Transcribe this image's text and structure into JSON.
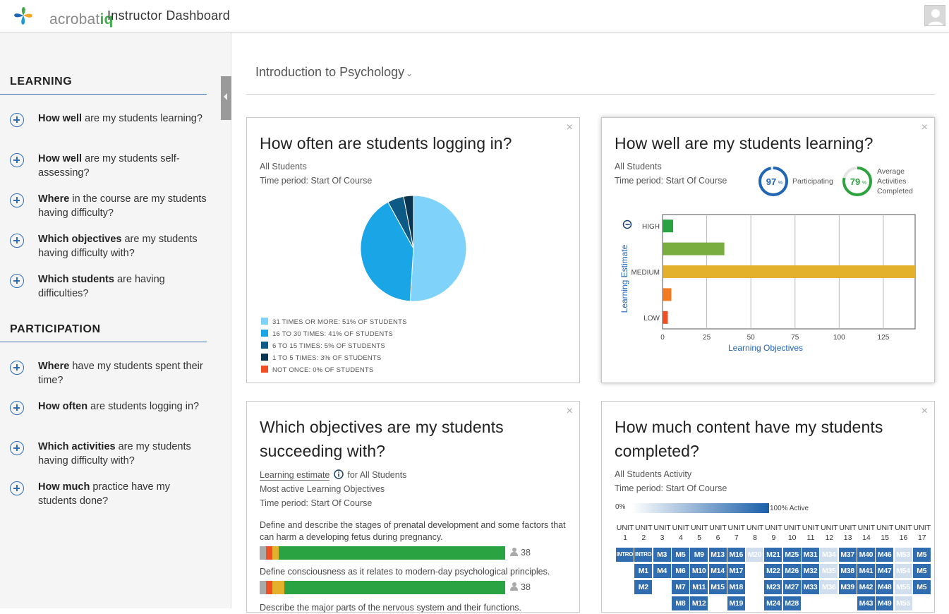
{
  "header": {
    "logo_text": "acrobat",
    "logo_text_suffix": "iq",
    "title": "Instructor Dashboard"
  },
  "sidebar": {
    "sections": [
      {
        "heading": "LEARNING",
        "items": [
          {
            "bold": "How well",
            "rest": " are my students learning?"
          },
          {
            "bold": "How well",
            "rest": " are my students self-assessing?"
          },
          {
            "bold": "Where",
            "rest": " in the course are my students having difficulty?"
          },
          {
            "bold": "Which objectives",
            "rest": " are my students having difficulty with?"
          },
          {
            "bold": "Which students",
            "rest": " are having difficulties?"
          }
        ]
      },
      {
        "heading": "PARTICIPATION",
        "items": [
          {
            "bold": "Where",
            "rest": " have my students spent their time?"
          },
          {
            "bold": "How often",
            "rest": " are students logging in?"
          },
          {
            "bold": "Which activities",
            "rest": " are my students having difficulty with?"
          },
          {
            "bold": "How much",
            "rest": " practice have my students done?"
          }
        ]
      }
    ]
  },
  "course": {
    "name": "Introduction to Psychology",
    "chevron": "⌄"
  },
  "close_glyph": "×",
  "card1": {
    "title": "How often are students logging in?",
    "meta1": "All Students",
    "meta2": "Time period: Start Of Course"
  },
  "card2": {
    "title": "How well are my students learning?",
    "meta1": "All Students",
    "meta2": "Time period: Start Of Course",
    "gauge1": {
      "value": "97",
      "unit": "%",
      "label": "Participating",
      "fraction": 0.97,
      "color": "#2166b6"
    },
    "gauge2": {
      "value": "79",
      "unit": "%",
      "label_lines": [
        "Average",
        "Activities",
        "Completed"
      ],
      "fraction": 0.79,
      "color": "#2ca33e"
    }
  },
  "card3": {
    "title_line1": "Which objectives are my students",
    "title_line2": "succeeding with?",
    "meta_link": "Learning estimate",
    "meta_suffix": "for All Students",
    "meta2": "Most active Learning Objectives",
    "meta3": "Time period: Start Of Course",
    "objectives": [
      {
        "text": "Define and describe the stages of prenatal development and some factors that can harm a developing fetus during pregnancy.",
        "count": "38",
        "segments": [
          {
            "fraction": 0.027,
            "color": "#aaaaaa"
          },
          {
            "fraction": 0.025,
            "color": "#f04e23"
          },
          {
            "fraction": 0.025,
            "color": "#e3b12c"
          },
          {
            "fraction": 0.923,
            "color": "#2aa342"
          }
        ]
      },
      {
        "text": "Define consciousness as it relates to modern-day psychological principles.",
        "count": "38",
        "segments": [
          {
            "fraction": 0.027,
            "color": "#aaaaaa"
          },
          {
            "fraction": 0.025,
            "color": "#f04e23"
          },
          {
            "fraction": 0.05,
            "color": "#e3b12c"
          },
          {
            "fraction": 0.898,
            "color": "#2aa342"
          }
        ]
      },
      {
        "text": "Describe the major parts of the nervous system and their functions.",
        "count": "",
        "segments": []
      }
    ]
  },
  "card4": {
    "title_line1": "How much content have my students",
    "title_line2": "completed?",
    "meta1": "All Students Activity",
    "meta2": "Time period: Start Of Course",
    "scale_min": "0%",
    "scale_max": "100% Active",
    "units": [
      "1",
      "2",
      "3",
      "4",
      "5",
      "6",
      "7",
      "8",
      "9",
      "10",
      "11",
      "12",
      "13",
      "14",
      "15",
      "16",
      "17"
    ],
    "unit_label": "UNIT",
    "modules": [
      [
        "INTRO"
      ],
      [
        "INTRO",
        "M1",
        "M2"
      ],
      [
        "M3",
        "M4"
      ],
      [
        "M5",
        "M6",
        "M7",
        "M8"
      ],
      [
        "M9",
        "M10",
        "M11",
        "M12"
      ],
      [
        "M13",
        "M14",
        "M15"
      ],
      [
        "M16",
        "M17",
        "M18",
        "M19"
      ],
      [
        "M20"
      ],
      [
        "M21",
        "M22",
        "M23",
        "M24"
      ],
      [
        "M25",
        "M26",
        "M27",
        "M28"
      ],
      [
        "M31",
        "M32",
        "M33"
      ],
      [
        "M34",
        "M35",
        "M36"
      ],
      [
        "M37",
        "M38",
        "M39"
      ],
      [
        "M40",
        "M41",
        "M42",
        "M43"
      ],
      [
        "M46",
        "M47",
        "M48",
        "M49"
      ],
      [
        "M53",
        "M54",
        "M55",
        "M56"
      ],
      [
        "M5",
        "M5",
        "M5"
      ]
    ],
    "module_activity": [
      [
        0.9
      ],
      [
        0.9,
        0.9,
        0.9
      ],
      [
        0.9,
        0.9
      ],
      [
        0.9,
        0.9,
        0.9,
        0.9
      ],
      [
        0.9,
        0.9,
        0.9,
        0.9
      ],
      [
        0.9,
        0.9,
        0.9
      ],
      [
        0.9,
        0.9,
        0.9,
        0.9
      ],
      [
        0.12
      ],
      [
        0.9,
        0.9,
        0.9,
        0.9
      ],
      [
        0.9,
        0.9,
        0.9,
        0.9
      ],
      [
        0.9,
        0.9,
        0.9
      ],
      [
        0.12,
        0.12,
        0.12
      ],
      [
        0.9,
        0.9,
        0.9
      ],
      [
        0.9,
        0.9,
        0.9,
        0.9
      ],
      [
        0.9,
        0.9,
        0.9,
        0.9
      ],
      [
        0.12,
        0.12,
        0.12,
        0.12
      ],
      [
        0.9,
        0.9,
        0.9
      ]
    ]
  },
  "chart_data": [
    {
      "type": "pie",
      "title": "How often are students logging in?",
      "categories": [
        "31 TIMES OR MORE: 51% OF STUDENTS",
        "16 TO 30 TIMES: 41% OF STUDENTS",
        "6 TO 15 TIMES: 5% OF STUDENTS",
        "1 TO 5 TIMES: 3% OF STUDENTS",
        "NOT ONCE: 0% OF STUDENTS"
      ],
      "values": [
        51,
        41,
        5,
        3,
        0
      ],
      "colors": [
        "#7fd3fb",
        "#1aa5e6",
        "#0e5a86",
        "#0a3550",
        "#f04e23"
      ],
      "legend": "bottom-left"
    },
    {
      "type": "bar",
      "orientation": "horizontal",
      "title": "How well are my students learning?",
      "categories": [
        "HIGH",
        "",
        "MEDIUM",
        "",
        "LOW"
      ],
      "values": [
        6,
        35,
        143,
        5,
        3
      ],
      "colors": [
        "#2aa342",
        "#7aad3f",
        "#e3b12c",
        "#f07b22",
        "#f04e23"
      ],
      "xlabel": "Learning Objectives",
      "ylabel": "Learning Estimate",
      "xticks": [
        "0",
        "25",
        "50",
        "75",
        "100",
        "125"
      ],
      "xlim": [
        0,
        143
      ],
      "grid": true
    }
  ]
}
